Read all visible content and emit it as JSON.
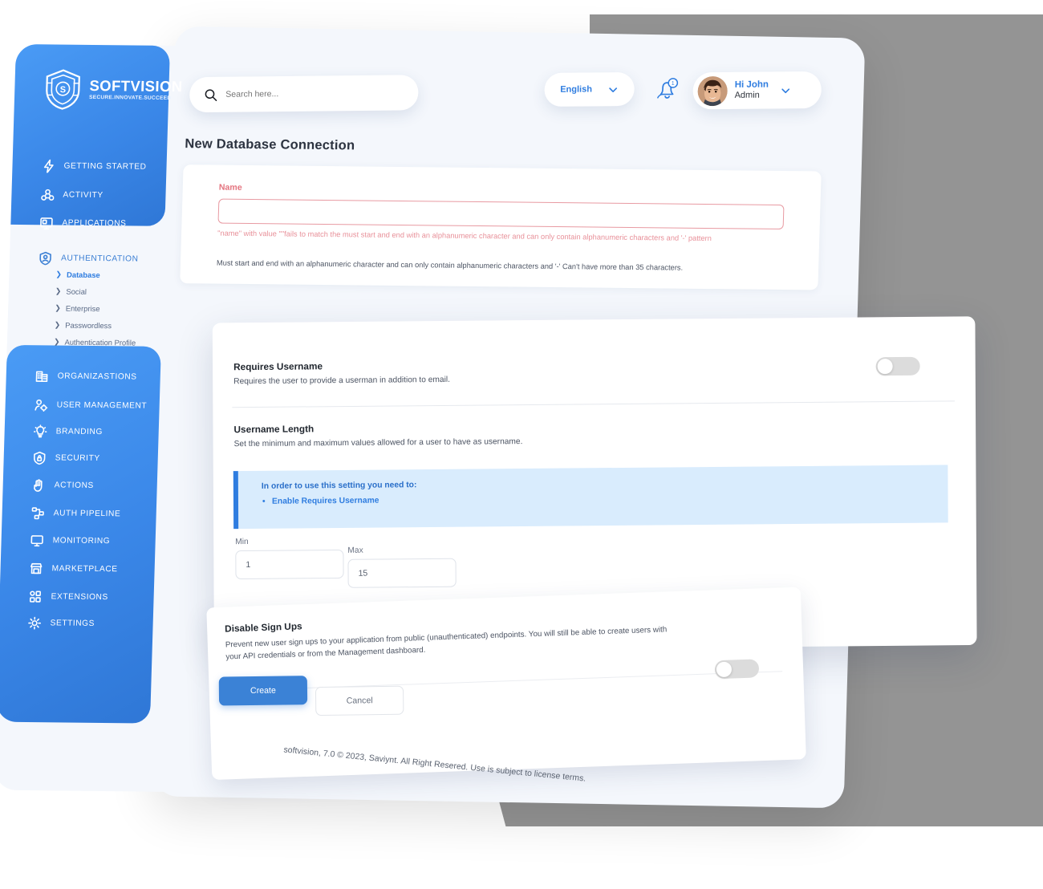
{
  "brand": {
    "name": "SOFTVISION",
    "tagline": "SECURE.INNOVATE.SUCCEED",
    "logo_icon": "shield-s-icon",
    "accent": "#3b82d6",
    "sidebar_blue": "#3a87e8",
    "error_red": "#e4747f",
    "canvas": "#f4f7fc"
  },
  "topbar": {
    "search_placeholder": "Search here...",
    "search_value": "",
    "search_icon": "search-icon",
    "language": "English",
    "language_chevron": "chevron-down-icon",
    "bell_icon": "bell-icon",
    "notification_count": "1",
    "avatar_icon": "user-avatar",
    "greeting": "Hi John",
    "role": "Admin",
    "user_chevron": "chevron-down-icon"
  },
  "sidebar": {
    "items": [
      {
        "label": "GETTING STARTED",
        "icon": "bolt-icon",
        "on_blue": true
      },
      {
        "label": "ACTIVITY",
        "icon": "activity-icon",
        "on_blue": true
      },
      {
        "label": "APPLICATIONS",
        "icon": "applications-icon",
        "on_blue": true
      },
      {
        "label": "AUTHENTICATION",
        "icon": "auth-shield-user-icon",
        "on_blue": false
      },
      {
        "label": "ORGANIZASTIONS",
        "icon": "building-icon",
        "on_blue": true
      },
      {
        "label": "USER MANAGEMENT",
        "icon": "user-gear-icon",
        "on_blue": true
      },
      {
        "label": "BRANDING",
        "icon": "branding-bulb-icon",
        "on_blue": true
      },
      {
        "label": "SECURITY",
        "icon": "lock-shield-icon",
        "on_blue": true
      },
      {
        "label": "ACTIONS",
        "icon": "hand-icon",
        "on_blue": true
      },
      {
        "label": "AUTH PIPELINE",
        "icon": "pipeline-icon",
        "on_blue": true
      },
      {
        "label": "MONITORING",
        "icon": "monitor-icon",
        "on_blue": true
      },
      {
        "label": "MARKETPLACE",
        "icon": "store-icon",
        "on_blue": true
      },
      {
        "label": "EXTENSIONS",
        "icon": "extensions-icon",
        "on_blue": true
      },
      {
        "label": "SETTINGS",
        "icon": "gear-icon",
        "on_blue": true
      }
    ],
    "sub_items": [
      {
        "label": "Database",
        "active": true,
        "icon": "chevron-right-icon"
      },
      {
        "label": "Social",
        "active": false,
        "icon": "chevron-right-icon"
      },
      {
        "label": "Enterprise",
        "active": false,
        "icon": "chevron-right-icon"
      },
      {
        "label": "Passwordless",
        "active": false,
        "icon": "chevron-right-icon"
      },
      {
        "label": "Authentication Profile",
        "active": false,
        "icon": "chevron-right-icon"
      }
    ]
  },
  "page": {
    "title": "New Database Connection"
  },
  "name_field": {
    "label": "Name",
    "value": "",
    "error": "\"name\" with value \"\"fails to match the must start and end with an alphanumeric character and can only contain alphanumeric characters and '-' pattern",
    "hint": "Must start and end with an alphanumeric character and can only contain alphanumeric characters and '-' Can't have more than 35 characters."
  },
  "requires_username": {
    "title": "Requires Username",
    "description": "Requires the user to provide a userman in addition to email.",
    "toggle_state": "off"
  },
  "username_length": {
    "title": "Username Length",
    "description": "Set the minimum and maximum values allowed for a user to have as username.",
    "note_heading": "In order to use this setting you need to:",
    "note_bullet": "Enable Requires Username",
    "min_label": "Min",
    "min_value": "1",
    "max_label": "Max",
    "max_value": "15"
  },
  "disable_signups": {
    "title": "Disable Sign Ups",
    "description": "Prevent new user sign ups to your application from public (unauthenticated) endpoints. You will still be able to create users with your API credentials or from the Management dashboard.",
    "toggle_state": "off"
  },
  "actions": {
    "create_label": "Create",
    "cancel_label": "Cancel"
  },
  "footer": {
    "text": "softvision, 7.0 © 2023, Saviynt. All Right Resered. Use is subject to license terms."
  }
}
